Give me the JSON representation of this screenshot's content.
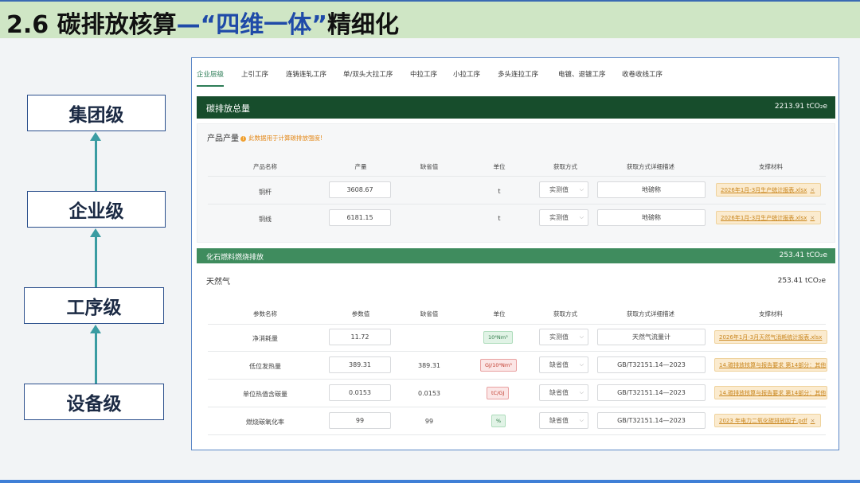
{
  "slide": {
    "title_prefix": "2.6 碳排放核算",
    "title_accent": "—“四维一体”",
    "title_suffix": "精细化"
  },
  "hierarchy": [
    "集团级",
    "企业级",
    "工序级",
    "设备级"
  ],
  "tabs": [
    "企业层级",
    "上引工序",
    "连铸连轧工序",
    "单/双头大拉工序",
    "中拉工序",
    "小拉工序",
    "多头连拉工序",
    "电镀、退镀工序",
    "收卷收线工序"
  ],
  "total": {
    "label": "碳排放总量",
    "value": "2213.91 tCO₂e"
  },
  "product": {
    "title": "产品产量",
    "note": "此数据用于计算碳排放强度!",
    "headers": [
      "产品名称",
      "产量",
      "缺省值",
      "单位",
      "获取方式",
      "获取方式详细描述",
      "支撑材料"
    ],
    "rows": [
      {
        "name": "铜杆",
        "value": "3608.67",
        "default": "",
        "unit": "t",
        "method": "实测值",
        "desc": "地磅称",
        "file": "2026年1月-3月生产统计报表.xlsx"
      },
      {
        "name": "铜线",
        "value": "6181.15",
        "default": "",
        "unit": "t",
        "method": "实测值",
        "desc": "地磅称",
        "file": "2026年1月-3月生产统计报表.xlsx"
      }
    ]
  },
  "fossil": {
    "label": "化石燃料燃烧排放",
    "value": "253.41 tCO₂e"
  },
  "gas": {
    "title": "天然气",
    "value": "253.41 tCO₂e",
    "headers": [
      "参数名称",
      "参数值",
      "缺省值",
      "单位",
      "获取方式",
      "获取方式详细描述",
      "支撑材料"
    ],
    "rows": [
      {
        "name": "净消耗量",
        "value": "11.72",
        "default": "",
        "unit": "10⁴Nm³",
        "method": "实测值",
        "desc": "天然气流量计",
        "file": "2026年1月-3月天然气消耗统计报表.xlsx"
      },
      {
        "name": "低位发热量",
        "value": "389.31",
        "default": "389.31",
        "unit": "GJ/10⁴Nm³",
        "method": "缺省值",
        "desc": "GB/T32151.14—2023",
        "file": "14.碳排放核算与报告要求 第14部分：其他"
      },
      {
        "name": "单位热值含碳量",
        "value": "0.0153",
        "default": "0.0153",
        "unit": "tC/GJ",
        "method": "缺省值",
        "desc": "GB/T32151.14—2023",
        "file": "14.碳排放核算与报告要求 第14部分：其他"
      },
      {
        "name": "燃烧碳氧化率",
        "value": "99",
        "default": "99",
        "unit": "%",
        "method": "缺省值",
        "desc": "GB/T32151.14—2023",
        "file": "2023 年电力二氧化碳排放因子.pdf"
      }
    ]
  },
  "colors": {
    "title_accent": "#1f4aa8",
    "dark_bar": "#174d2c",
    "green_bar": "#3f8c5e",
    "file_tag": "#fbebcf"
  }
}
